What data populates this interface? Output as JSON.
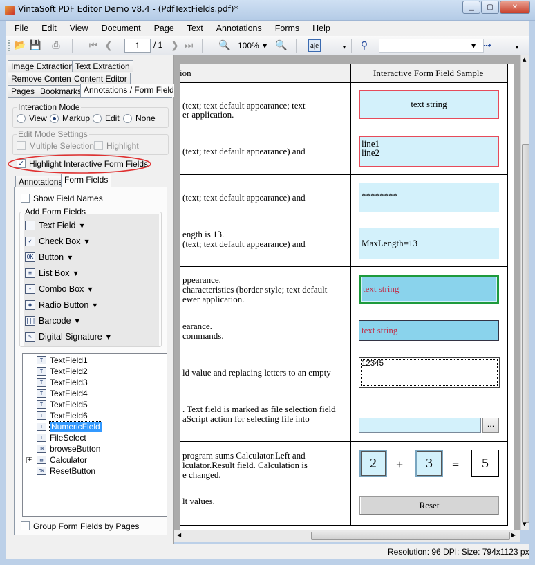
{
  "window": {
    "title": "VintaSoft PDF Editor Demo v8.4 -  (PdfTextFields.pdf)*"
  },
  "menu": [
    "File",
    "Edit",
    "View",
    "Document",
    "Page",
    "Text",
    "Annotations",
    "Forms",
    "Help"
  ],
  "toolbar": {
    "page_number": "1",
    "page_total": "/ 1",
    "zoom": "100%"
  },
  "panel_tabs": {
    "row1": [
      "Image Extraction",
      "Text Extraction"
    ],
    "row2": [
      "Remove Content",
      "Content Editor"
    ],
    "row3": [
      "Pages",
      "Bookmarks",
      "Annotations / Form Fields"
    ]
  },
  "interaction_mode": {
    "label": "Interaction Mode",
    "options": [
      "View",
      "Markup",
      "Edit",
      "None"
    ],
    "selected": "Markup"
  },
  "edit_mode_settings": {
    "label": "Edit Mode Settings",
    "multiple_selection": "Multiple Selection",
    "highlight": "Highlight"
  },
  "highlight_fields": {
    "label": "Highlight Interactive Form  Fields",
    "checked": true
  },
  "sub_tabs": [
    "Annotations",
    "Form Fields"
  ],
  "show_field_names": "Show Field Names",
  "add_form_fields": {
    "label": "Add Form Fields",
    "items": [
      {
        "label": "Text Field",
        "icon": "text-field-icon",
        "glyph": "T"
      },
      {
        "label": "Check Box",
        "icon": "check-box-icon",
        "glyph": "✓"
      },
      {
        "label": "Button",
        "icon": "button-icon",
        "glyph": "OK"
      },
      {
        "label": "List Box",
        "icon": "list-box-icon",
        "glyph": "≡"
      },
      {
        "label": "Combo Box",
        "icon": "combo-box-icon",
        "glyph": "▾"
      },
      {
        "label": "Radio Button",
        "icon": "radio-button-icon",
        "glyph": "◉"
      },
      {
        "label": "Barcode",
        "icon": "barcode-icon",
        "glyph": "|||"
      },
      {
        "label": "Digital Signature",
        "icon": "digital-signature-icon",
        "glyph": "✎"
      }
    ]
  },
  "tree": [
    {
      "label": "TextField1",
      "glyph": "T"
    },
    {
      "label": "TextField2",
      "glyph": "T"
    },
    {
      "label": "TextField3",
      "glyph": "T"
    },
    {
      "label": "TextField4",
      "glyph": "T"
    },
    {
      "label": "TextField5",
      "glyph": "T"
    },
    {
      "label": "TextField6",
      "glyph": "T"
    },
    {
      "label": "NumericField",
      "glyph": "T",
      "selected": true
    },
    {
      "label": "FileSelect",
      "glyph": "T"
    },
    {
      "label": "browseButton",
      "glyph": "OK"
    },
    {
      "label": "Calculator",
      "glyph": "▤",
      "expandable": true
    },
    {
      "label": "ResetButton",
      "glyph": "OK"
    }
  ],
  "group_by_pages": "Group Form Fields by Pages",
  "document": {
    "col1_header": "ion",
    "col2_header": "Interactive Form Field Sample",
    "rows": [
      {
        "desc": [
          "(text; text default appearance; text",
          "er application."
        ],
        "field": "text string"
      },
      {
        "desc": [
          "(text; text default appearance) and"
        ],
        "field_lines": [
          "line1",
          "line2"
        ]
      },
      {
        "desc": [
          "(text; text default appearance) and"
        ],
        "field": "********"
      },
      {
        "desc": [
          "ength is 13.",
          "(text; text default appearance) and"
        ],
        "field": "MaxLength=13"
      },
      {
        "desc": [
          "ppearance.",
          "characteristics (border style; text default",
          "ewer application."
        ],
        "field": "text string"
      },
      {
        "desc": [
          "earance.",
          "commands."
        ],
        "field": "text string"
      },
      {
        "desc": [
          "ld value and replacing letters to an empty"
        ],
        "field": "12345"
      },
      {
        "desc": [
          ". Text field is marked as file selection field",
          "aScript action for selecting file into"
        ],
        "browse": "..."
      },
      {
        "desc": [
          "program sums Calculator.Left and",
          "lculator.Result field. Calculation is",
          "e changed."
        ],
        "calc": {
          "left": "2",
          "op": "+",
          "right": "3",
          "eq": "=",
          "result": "5"
        }
      },
      {
        "desc": [
          "lt values."
        ],
        "button": "Reset"
      }
    ]
  },
  "status": "Resolution: 96 DPI; Size: 794x1123 px",
  "colors": {
    "field_bg": "#d3f1fb",
    "field_bg_dark": "#8ad3ec",
    "highlight_red": "#e64b5a",
    "highlight_green": "#1e9a3c",
    "annotation_red": "#e03030"
  }
}
